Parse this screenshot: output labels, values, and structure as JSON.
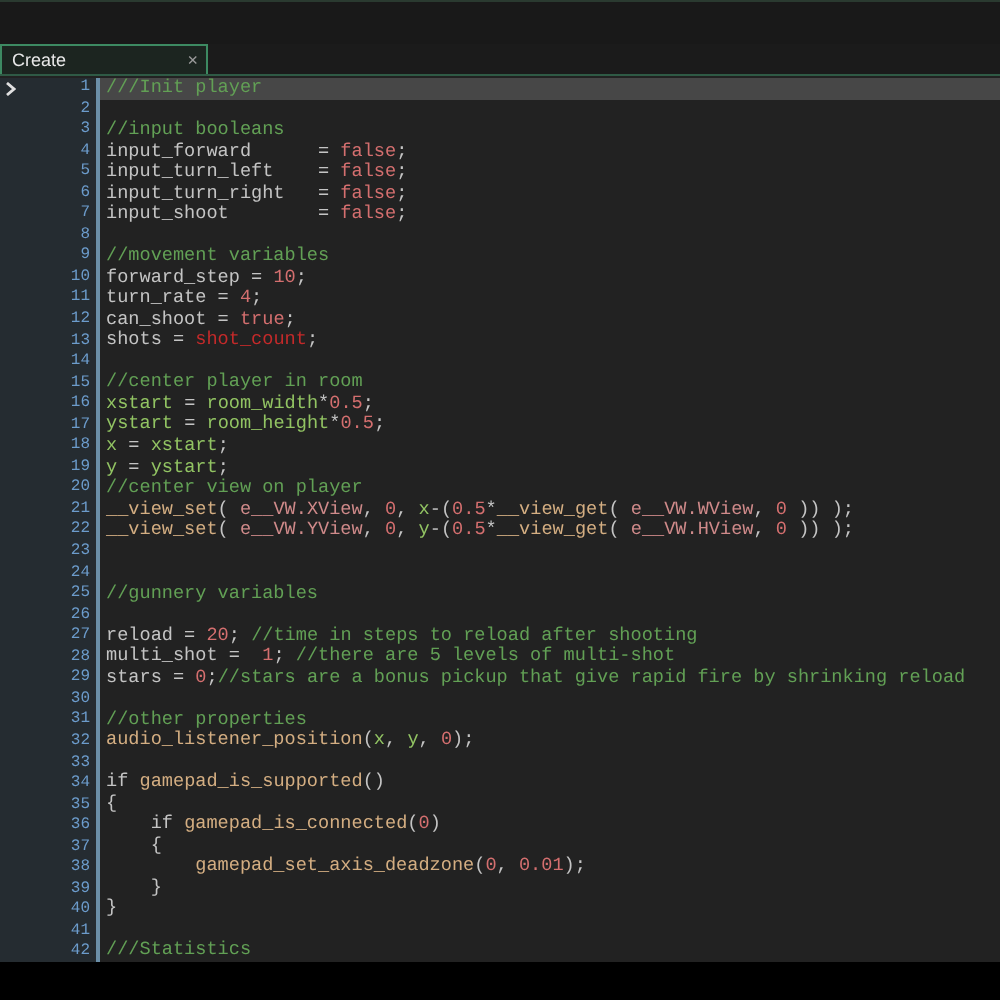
{
  "tab": {
    "label": "Create",
    "close": "×",
    "selected": true
  },
  "lines": [
    {
      "number": "1",
      "selected": true,
      "tokens": [
        {
          "kind": "comment",
          "text": "///Init player"
        }
      ]
    },
    {
      "number": "2",
      "selected": false
    },
    {
      "number": "3",
      "selected": false,
      "tokens": [
        {
          "kind": "comment",
          "text": "//input booleans"
        }
      ]
    },
    {
      "number": "4",
      "selected": false,
      "tokens": [
        {
          "kind": "plain",
          "text": "input_forward      = "
        },
        {
          "kind": "literal",
          "text": "false"
        },
        {
          "kind": "plain",
          "text": ";"
        }
      ]
    },
    {
      "number": "5",
      "selected": false,
      "tokens": [
        {
          "kind": "plain",
          "text": "input_turn_left    = "
        },
        {
          "kind": "literal",
          "text": "false"
        },
        {
          "kind": "plain",
          "text": ";"
        }
      ]
    },
    {
      "number": "6",
      "selected": false,
      "tokens": [
        {
          "kind": "plain",
          "text": "input_turn_right   = "
        },
        {
          "kind": "literal",
          "text": "false"
        },
        {
          "kind": "plain",
          "text": ";"
        }
      ]
    },
    {
      "number": "7",
      "selected": false,
      "tokens": [
        {
          "kind": "plain",
          "text": "input_shoot        = "
        },
        {
          "kind": "literal",
          "text": "false"
        },
        {
          "kind": "plain",
          "text": ";"
        }
      ]
    },
    {
      "number": "8",
      "selected": false
    },
    {
      "number": "9",
      "selected": false,
      "tokens": [
        {
          "kind": "comment",
          "text": "//movement variables"
        }
      ]
    },
    {
      "number": "10",
      "selected": false,
      "tokens": [
        {
          "kind": "plain",
          "text": "forward_step = "
        },
        {
          "kind": "literal",
          "text": "10"
        },
        {
          "kind": "plain",
          "text": ";"
        }
      ]
    },
    {
      "number": "11",
      "selected": false,
      "tokens": [
        {
          "kind": "plain",
          "text": "turn_rate = "
        },
        {
          "kind": "literal",
          "text": "4"
        },
        {
          "kind": "plain",
          "text": ";"
        }
      ]
    },
    {
      "number": "12",
      "selected": false,
      "tokens": [
        {
          "kind": "plain",
          "text": "can_shoot = "
        },
        {
          "kind": "literal",
          "text": "true"
        },
        {
          "kind": "plain",
          "text": ";"
        }
      ]
    },
    {
      "number": "13",
      "selected": false,
      "tokens": [
        {
          "kind": "plain",
          "text": "shots = "
        },
        {
          "kind": "error",
          "text": "shot_count"
        },
        {
          "kind": "plain",
          "text": ";"
        }
      ]
    },
    {
      "number": "14",
      "selected": false
    },
    {
      "number": "15",
      "selected": false,
      "tokens": [
        {
          "kind": "comment",
          "text": "//center player in room"
        }
      ]
    },
    {
      "number": "16",
      "selected": false,
      "tokens": [
        {
          "kind": "builtin",
          "text": "xstart"
        },
        {
          "kind": "plain",
          "text": " = "
        },
        {
          "kind": "builtin",
          "text": "room_width"
        },
        {
          "kind": "plain",
          "text": "*"
        },
        {
          "kind": "literal",
          "text": "0.5"
        },
        {
          "kind": "plain",
          "text": ";"
        }
      ]
    },
    {
      "number": "17",
      "selected": false,
      "tokens": [
        {
          "kind": "builtin",
          "text": "ystart"
        },
        {
          "kind": "plain",
          "text": " = "
        },
        {
          "kind": "builtin",
          "text": "room_height"
        },
        {
          "kind": "plain",
          "text": "*"
        },
        {
          "kind": "literal",
          "text": "0.5"
        },
        {
          "kind": "plain",
          "text": ";"
        }
      ]
    },
    {
      "number": "18",
      "selected": false,
      "tokens": [
        {
          "kind": "builtin",
          "text": "x"
        },
        {
          "kind": "plain",
          "text": " = "
        },
        {
          "kind": "builtin",
          "text": "xstart"
        },
        {
          "kind": "plain",
          "text": ";"
        }
      ]
    },
    {
      "number": "19",
      "selected": false,
      "tokens": [
        {
          "kind": "builtin",
          "text": "y"
        },
        {
          "kind": "plain",
          "text": " = "
        },
        {
          "kind": "builtin",
          "text": "ystart"
        },
        {
          "kind": "plain",
          "text": ";"
        }
      ]
    },
    {
      "number": "20",
      "selected": false,
      "tokens": [
        {
          "kind": "comment",
          "text": "//center view on player"
        }
      ]
    },
    {
      "number": "21",
      "selected": false,
      "tokens": [
        {
          "kind": "function",
          "text": "__view_set"
        },
        {
          "kind": "plain",
          "text": "( "
        },
        {
          "kind": "constant",
          "text": "e__VW.XView"
        },
        {
          "kind": "plain",
          "text": ", "
        },
        {
          "kind": "literal",
          "text": "0"
        },
        {
          "kind": "plain",
          "text": ", "
        },
        {
          "kind": "builtin",
          "text": "x"
        },
        {
          "kind": "plain",
          "text": "-("
        },
        {
          "kind": "literal",
          "text": "0.5"
        },
        {
          "kind": "plain",
          "text": "*"
        },
        {
          "kind": "function",
          "text": "__view_get"
        },
        {
          "kind": "plain",
          "text": "( "
        },
        {
          "kind": "constant",
          "text": "e__VW.WView"
        },
        {
          "kind": "plain",
          "text": ", "
        },
        {
          "kind": "literal",
          "text": "0"
        },
        {
          "kind": "plain",
          "text": " )) );"
        }
      ]
    },
    {
      "number": "22",
      "selected": false,
      "tokens": [
        {
          "kind": "function",
          "text": "__view_set"
        },
        {
          "kind": "plain",
          "text": "( "
        },
        {
          "kind": "constant",
          "text": "e__VW.YView"
        },
        {
          "kind": "plain",
          "text": ", "
        },
        {
          "kind": "literal",
          "text": "0"
        },
        {
          "kind": "plain",
          "text": ", "
        },
        {
          "kind": "builtin",
          "text": "y"
        },
        {
          "kind": "plain",
          "text": "-("
        },
        {
          "kind": "literal",
          "text": "0.5"
        },
        {
          "kind": "plain",
          "text": "*"
        },
        {
          "kind": "function",
          "text": "__view_get"
        },
        {
          "kind": "plain",
          "text": "( "
        },
        {
          "kind": "constant",
          "text": "e__VW.HView"
        },
        {
          "kind": "plain",
          "text": ", "
        },
        {
          "kind": "literal",
          "text": "0"
        },
        {
          "kind": "plain",
          "text": " )) );"
        }
      ]
    },
    {
      "number": "23",
      "selected": false
    },
    {
      "number": "24",
      "selected": false
    },
    {
      "number": "25",
      "selected": false,
      "tokens": [
        {
          "kind": "comment",
          "text": "//gunnery variables"
        }
      ]
    },
    {
      "number": "26",
      "selected": false
    },
    {
      "number": "27",
      "selected": false,
      "tokens": [
        {
          "kind": "plain",
          "text": "reload = "
        },
        {
          "kind": "literal",
          "text": "20"
        },
        {
          "kind": "plain",
          "text": "; "
        },
        {
          "kind": "comment",
          "text": "//time in steps to reload after shooting"
        }
      ]
    },
    {
      "number": "28",
      "selected": false,
      "tokens": [
        {
          "kind": "plain",
          "text": "multi_shot =  "
        },
        {
          "kind": "literal",
          "text": "1"
        },
        {
          "kind": "plain",
          "text": "; "
        },
        {
          "kind": "comment",
          "text": "//there are 5 levels of multi-shot"
        }
      ]
    },
    {
      "number": "29",
      "selected": false,
      "tokens": [
        {
          "kind": "plain",
          "text": "stars = "
        },
        {
          "kind": "literal",
          "text": "0"
        },
        {
          "kind": "plain",
          "text": ";"
        },
        {
          "kind": "comment",
          "text": "//stars are a bonus pickup that give rapid fire by shrinking reload"
        }
      ]
    },
    {
      "number": "30",
      "selected": false
    },
    {
      "number": "31",
      "selected": false,
      "tokens": [
        {
          "kind": "comment",
          "text": "//other properties"
        }
      ]
    },
    {
      "number": "32",
      "selected": false,
      "tokens": [
        {
          "kind": "function",
          "text": "audio_listener_position"
        },
        {
          "kind": "plain",
          "text": "("
        },
        {
          "kind": "builtin",
          "text": "x"
        },
        {
          "kind": "plain",
          "text": ", "
        },
        {
          "kind": "builtin",
          "text": "y"
        },
        {
          "kind": "plain",
          "text": ", "
        },
        {
          "kind": "literal",
          "text": "0"
        },
        {
          "kind": "plain",
          "text": ");"
        }
      ]
    },
    {
      "number": "33",
      "selected": false
    },
    {
      "number": "34",
      "selected": false,
      "tokens": [
        {
          "kind": "plain",
          "text": "if "
        },
        {
          "kind": "function",
          "text": "gamepad_is_supported"
        },
        {
          "kind": "plain",
          "text": "()"
        }
      ]
    },
    {
      "number": "35",
      "selected": false,
      "tokens": [
        {
          "kind": "plain",
          "text": "{"
        }
      ]
    },
    {
      "number": "36",
      "selected": false,
      "tokens": [
        {
          "kind": "plain",
          "text": "    if "
        },
        {
          "kind": "function",
          "text": "gamepad_is_connected"
        },
        {
          "kind": "plain",
          "text": "("
        },
        {
          "kind": "literal",
          "text": "0"
        },
        {
          "kind": "plain",
          "text": ")"
        }
      ]
    },
    {
      "number": "37",
      "selected": false,
      "tokens": [
        {
          "kind": "plain",
          "text": "    {"
        }
      ]
    },
    {
      "number": "38",
      "selected": false,
      "tokens": [
        {
          "kind": "function",
          "text": "        gamepad_set_axis_deadzone"
        },
        {
          "kind": "plain",
          "text": "("
        },
        {
          "kind": "literal",
          "text": "0"
        },
        {
          "kind": "plain",
          "text": ", "
        },
        {
          "kind": "literal",
          "text": "0.01"
        },
        {
          "kind": "plain",
          "text": ");"
        }
      ]
    },
    {
      "number": "39",
      "selected": false,
      "tokens": [
        {
          "kind": "plain",
          "text": "    }"
        }
      ]
    },
    {
      "number": "40",
      "selected": false,
      "tokens": [
        {
          "kind": "plain",
          "text": "}"
        }
      ]
    },
    {
      "number": "41",
      "selected": false
    },
    {
      "number": "42",
      "selected": false,
      "tokens": [
        {
          "kind": "comment",
          "text": "///Statistics"
        }
      ]
    }
  ]
}
